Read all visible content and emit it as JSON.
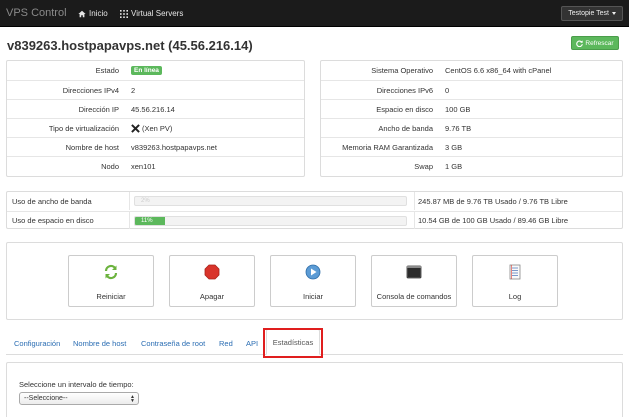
{
  "nav": {
    "brand": "VPS Control",
    "home_label": "Inicio",
    "servers_label": "Virtual Servers",
    "user_label": "Testopie Test"
  },
  "header": {
    "title": "v839263.hostpapavps.net (45.56.216.14)",
    "refresh_label": "Refrescar"
  },
  "left_info": [
    {
      "label": "Estado",
      "value": "En línea"
    },
    {
      "label": "Direcciones IPv4",
      "value": "2"
    },
    {
      "label": "Dirección IP",
      "value": "45.56.216.14"
    },
    {
      "label": "Tipo de virtualización",
      "value": "(Xen PV)"
    },
    {
      "label": "Nombre de host",
      "value": "v839263.hostpapavps.net"
    },
    {
      "label": "Nodo",
      "value": "xen101"
    }
  ],
  "right_info": [
    {
      "label": "Sistema Operativo",
      "value": "CentOS 6.6 x86_64 with cPanel"
    },
    {
      "label": "Direcciones IPv6",
      "value": "0"
    },
    {
      "label": "Espacio en disco",
      "value": "100 GB"
    },
    {
      "label": "Ancho de banda",
      "value": "9.76 TB"
    },
    {
      "label": "Memoria RAM Garantizada",
      "value": "3 GB"
    },
    {
      "label": "Swap",
      "value": "1 GB"
    }
  ],
  "usage": [
    {
      "label": "Uso de ancho de banda",
      "percent_text": "2%",
      "fraction": 0.0,
      "text": "245.87 MB de 9.76 TB Usado / 9.76 TB Libre"
    },
    {
      "label": "Uso de espacio en disco",
      "percent_text": "11%",
      "fraction": 0.11,
      "text": "10.54 GB de 100 GB Usado / 89.46 GB Libre"
    }
  ],
  "actions": {
    "restart": "Reiniciar",
    "shutdown": "Apagar",
    "start": "Iniciar",
    "console": "Consola de comandos",
    "log": "Log"
  },
  "tabs": {
    "config": "Configuración",
    "hostname": "Nombre de host",
    "root_password": "Contraseña de root",
    "network": "Red",
    "api": "API",
    "stats": "Estadísticas"
  },
  "stats": {
    "interval_label": "Seleccione un intervalo de tiempo:",
    "interval_value": "--Seleccione--"
  },
  "colors": {
    "accent_green": "#5cb85c",
    "link_blue": "#2a6db3",
    "highlight_red": "#e01e1e",
    "navbar": "#1b1b1b"
  }
}
